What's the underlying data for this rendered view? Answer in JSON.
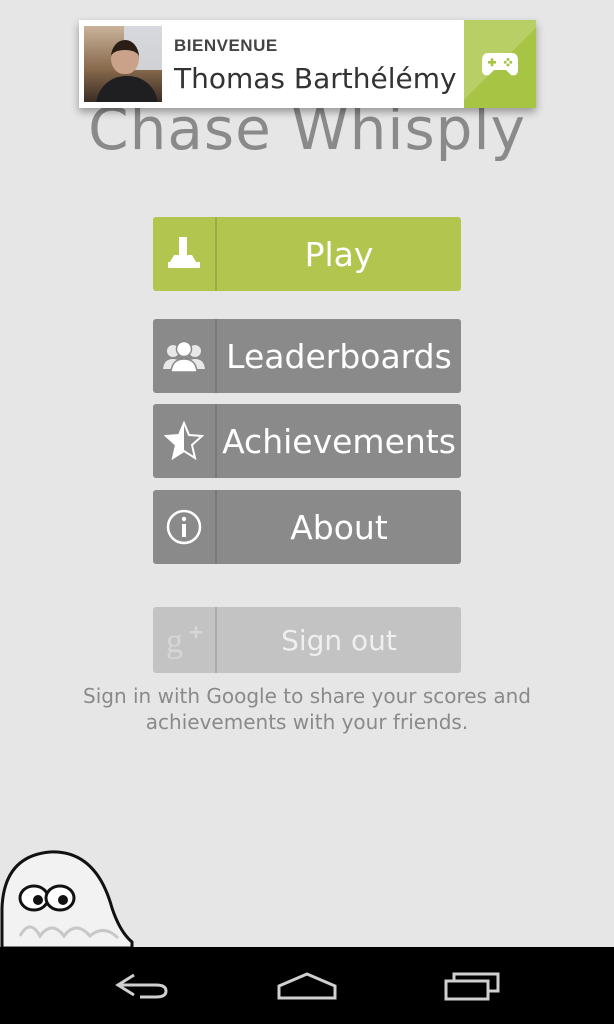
{
  "app": {
    "title": "Chase Whisply"
  },
  "welcome": {
    "label": "BIENVENUE",
    "name": "Thomas Barthélémy"
  },
  "menu": {
    "play": "Play",
    "leaderboards": "Leaderboards",
    "achievements": "Achievements",
    "about": "About",
    "sign_out": "Sign out"
  },
  "signin_note": "Sign in with Google to share your scores and achievements with your friends.",
  "icons": {
    "play": "joystick-icon",
    "leaderboards": "people-group-icon",
    "achievements": "half-star-icon",
    "about": "info-icon",
    "sign_out": "google-plus-icon",
    "games_badge": "gamepad-icon",
    "nav_back": "back-icon",
    "nav_home": "home-icon",
    "nav_recents": "recent-apps-icon"
  },
  "colors": {
    "background": "#e6e6e6",
    "play_green": "#b2c54f",
    "button_gray": "#8a8a8a",
    "signout_gray": "#c3c3c3",
    "badge_green": "#a8c444"
  }
}
